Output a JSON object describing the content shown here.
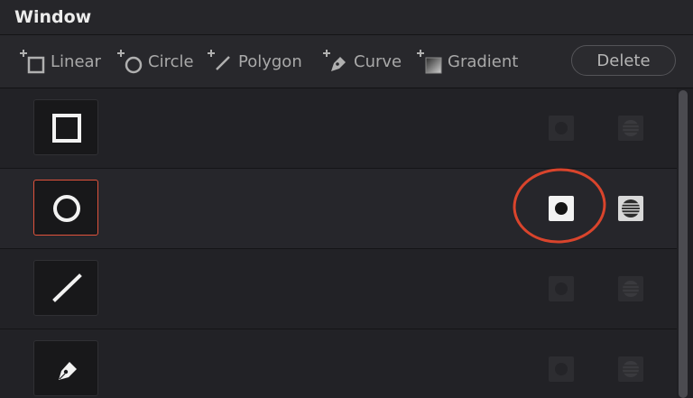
{
  "window": {
    "title": "Window"
  },
  "toolbar": {
    "tools": [
      {
        "label": "Linear",
        "icon": "linear-add-icon"
      },
      {
        "label": "Circle",
        "icon": "circle-add-icon"
      },
      {
        "label": "Polygon",
        "icon": "polygon-add-icon"
      },
      {
        "label": "Curve",
        "icon": "curve-add-icon"
      },
      {
        "label": "Gradient",
        "icon": "gradient-add-icon"
      }
    ],
    "delete_label": "Delete"
  },
  "windows": [
    {
      "shape": "square",
      "active": false,
      "enabled": false,
      "inverted": false
    },
    {
      "shape": "circle",
      "active": true,
      "enabled": true,
      "inverted": true
    },
    {
      "shape": "line",
      "active": false,
      "enabled": false,
      "inverted": false
    },
    {
      "shape": "pen",
      "active": false,
      "enabled": false,
      "inverted": false
    }
  ],
  "colors": {
    "active_border": "#e0533c",
    "annotation": "#d9442c",
    "background": "#1f1f22"
  }
}
